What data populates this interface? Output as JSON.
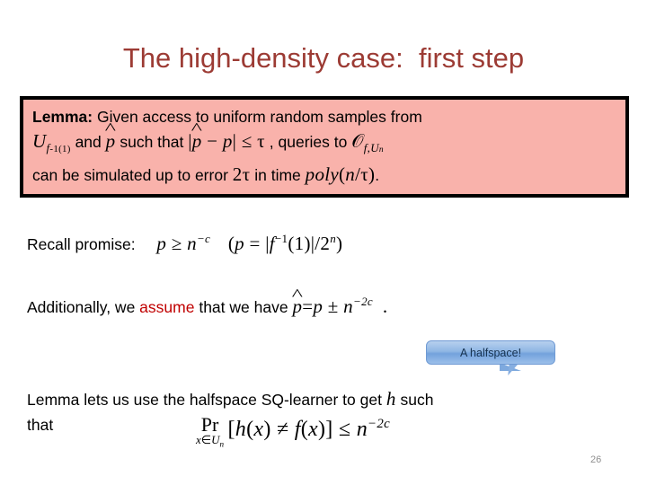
{
  "slide": {
    "title": "The high-density case:  first step",
    "title_color": "#9c3b34",
    "page_number": "26",
    "background": "#ffffff"
  },
  "lemma_box": {
    "background": "#f9b2ab",
    "border_color": "#000000",
    "label": "Lemma:",
    "line1_text": " Given access to uniform random samples from",
    "line2": {
      "math_U": "U",
      "math_U_sub_f": "f",
      "math_U_sub_inv": "-1",
      "math_U_sub_one": "(1)",
      "and_text": "and",
      "math_phat": "p",
      "such_that_text": "such that",
      "math_abs_open": "|",
      "math_phat2": "p",
      "math_minus": "−",
      "math_p": "p",
      "math_abs_close": "|",
      "math_leq": "≤",
      "math_tau": "τ",
      "queries_text": ", queries to",
      "math_oracle": "𝒪",
      "math_oracle_sub": "f,U",
      "math_oracle_sub_n": "n"
    },
    "line3": {
      "pre_text": "can be simulated up to error",
      "math_two": "2",
      "math_tau": "τ",
      "mid_text": "in time",
      "math_poly": "poly",
      "math_paren_open": "(",
      "math_n": "n",
      "math_slash": "/",
      "math_tau2": "τ",
      "math_paren_close": ")",
      "period": "."
    }
  },
  "recall_row": {
    "label": "Recall promise:",
    "math_p": "p",
    "math_geq": "≥",
    "math_n": "n",
    "math_exp": "−c",
    "paren_open": "(",
    "math_p2": "p",
    "math_eq": "=",
    "abs_open": "|",
    "math_f": "f",
    "math_f_exp": "−1",
    "math_f_arg": "(1)",
    "abs_close": "|",
    "math_div": "/2",
    "math_div_exp": "n",
    "paren_close": ")"
  },
  "additionally_row": {
    "pre_text": "Additionally, we",
    "accent_word": "assume",
    "accent_color": "#c00000",
    "mid_text": "that we have",
    "math_phat": "p",
    "math_eq": "=",
    "math_p": "p",
    "math_pm": "±",
    "math_n": "n",
    "math_exp": "−2c",
    "period": "."
  },
  "callout": {
    "label": "A halfspace!",
    "fill_top": "#b7d0ee",
    "fill_bottom": "#73a2dc",
    "border_color": "#6f9ad4",
    "text_color": "#15314f"
  },
  "conclusion_row": {
    "pre_text": "Lemma lets us use the halfspace SQ-learner to get",
    "math_h": "h",
    "post_text": "such",
    "line2_text": "that"
  },
  "conclusion_formula": {
    "pr_main": "Pr",
    "pr_sub_x": "x",
    "pr_sub_in": "∈",
    "pr_sub_U": "U",
    "pr_sub_n": "n",
    "bracket_open": "[",
    "math_h": "h",
    "arg_open": "(",
    "math_x": "x",
    "arg_close": ")",
    "math_neq": "≠",
    "math_f": "f",
    "arg2_open": "(",
    "math_x2": "x",
    "arg2_close": ")",
    "bracket_close": "]",
    "math_leq": "≤",
    "math_n": "n",
    "math_exp": "−2c"
  }
}
